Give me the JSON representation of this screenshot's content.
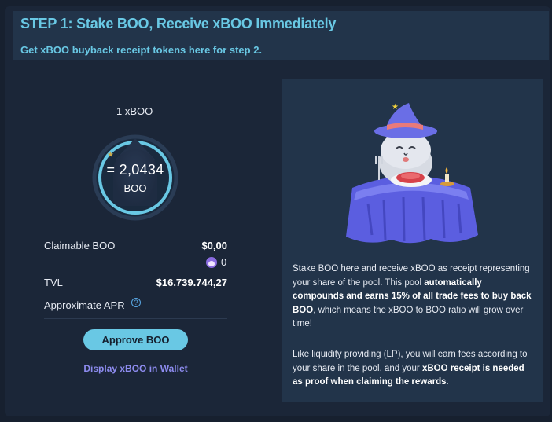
{
  "header": {
    "title": "STEP 1: Stake BOO, Receive xBOO Immediately",
    "subtitle": "Get xBOO buyback receipt tokens here for step 2."
  },
  "ratio_card": {
    "unit_top": "1 xBOO",
    "ratio_value": "= 2,0434",
    "ratio_unit": "BOO"
  },
  "stats": {
    "claimable_label": "Claimable BOO",
    "claimable_value": "$0,00",
    "claimable_tokens": "0",
    "tvl_label": "TVL",
    "tvl_value": "$16.739.744,27",
    "apr_label": "Approximate APR",
    "help_glyph": "?"
  },
  "actions": {
    "approve_label": "Approve BOO",
    "wallet_link_label": "Display xBOO in Wallet"
  },
  "info_panel": {
    "p1_a": "Stake BOO here and receive xBOO as receipt representing your share of the pool. This pool ",
    "p1_b": "automatically compounds and earns 15% of all trade fees to buy back BOO",
    "p1_c": ", which means the xBOO to BOO ratio will grow over time!",
    "p2_a": "Like liquidity providing (LP), you will earn fees according to your share in the pool, and your ",
    "p2_b": "xBOO receipt is needed as proof when claiming the rewards",
    "p2_c": "."
  },
  "icons": {
    "boo_token": "boo-token-icon",
    "help": "question-circle-icon",
    "illustration": "cat-wizard-illustration"
  },
  "colors": {
    "accent": "#69c8e4",
    "link": "#8e8cf0",
    "background": "#1b2638",
    "panel": "#22344a"
  }
}
